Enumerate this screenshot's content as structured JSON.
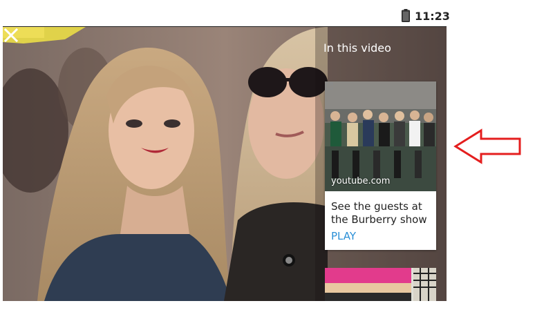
{
  "status_bar": {
    "time": "11:23",
    "battery_icon": "battery-icon"
  },
  "video": {
    "panel": {
      "title": "In this video",
      "close_icon": "close-icon",
      "card": {
        "source": "youtube.com",
        "title": "See the guests at the Burberry show",
        "action_label": "PLAY",
        "action_icon": "external-link-icon"
      }
    }
  },
  "annotation": {
    "arrow_color": "#e41e1e"
  },
  "colors": {
    "link": "#2a8fd6",
    "panel_text": "#ffffff",
    "card_background": "#ffffff"
  }
}
